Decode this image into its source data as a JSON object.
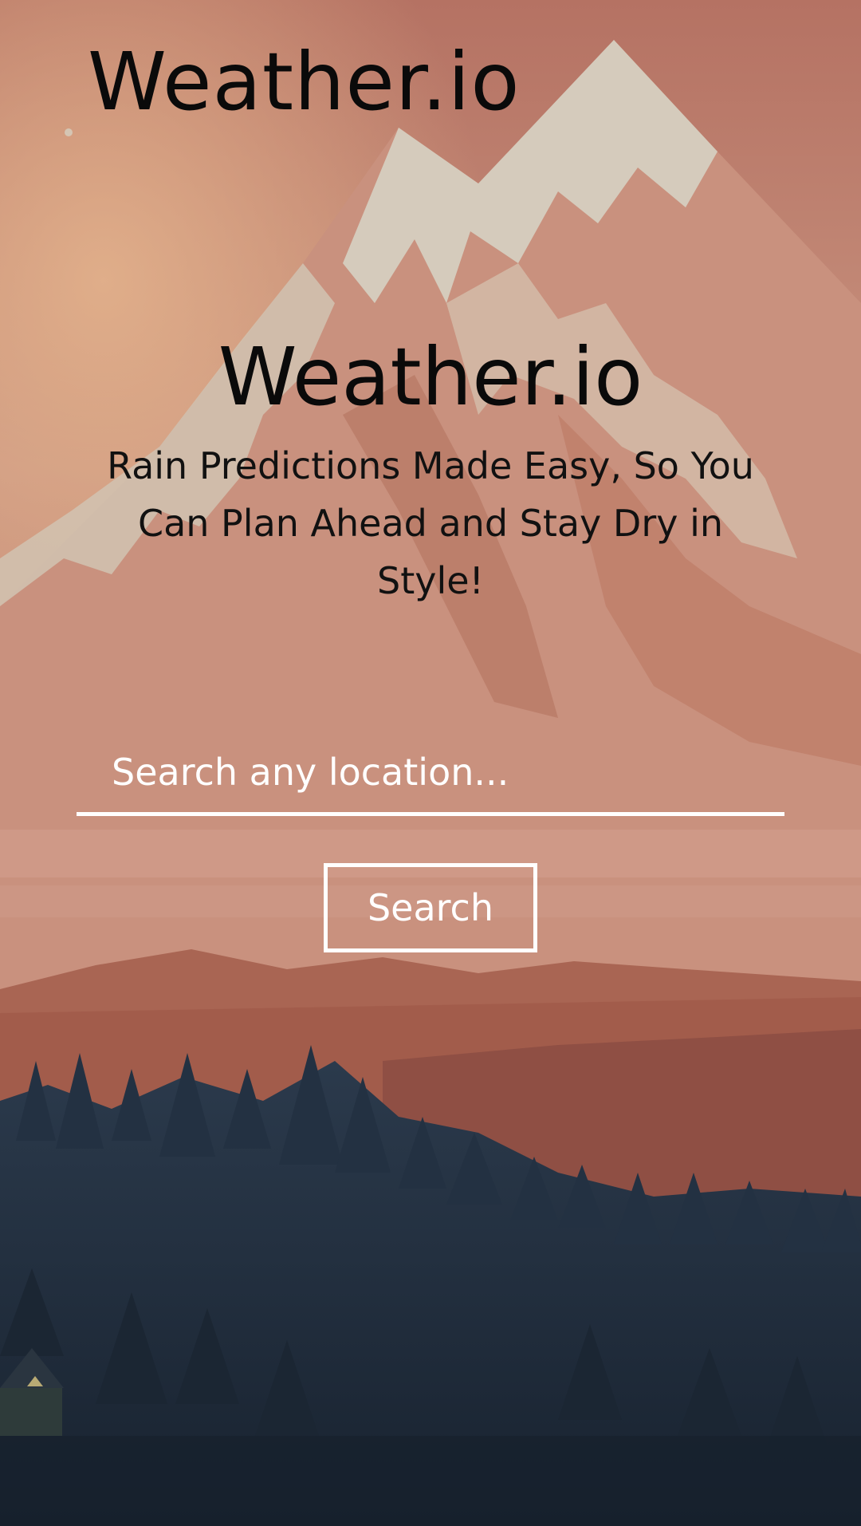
{
  "header": {
    "brand": "Weather.io"
  },
  "hero": {
    "title": "Weather.io",
    "subtitle": "Rain Predictions Made Easy, So You Can Plan Ahead and Stay Dry in Style!"
  },
  "search": {
    "placeholder": "Search any location...",
    "value": "",
    "button_label": "Search"
  },
  "colors": {
    "sky": "#c28a77",
    "snow": "#d9d2c2",
    "mountain": "#c27e6a",
    "forest": "#1d2a3a",
    "accent": "#ffffff"
  }
}
